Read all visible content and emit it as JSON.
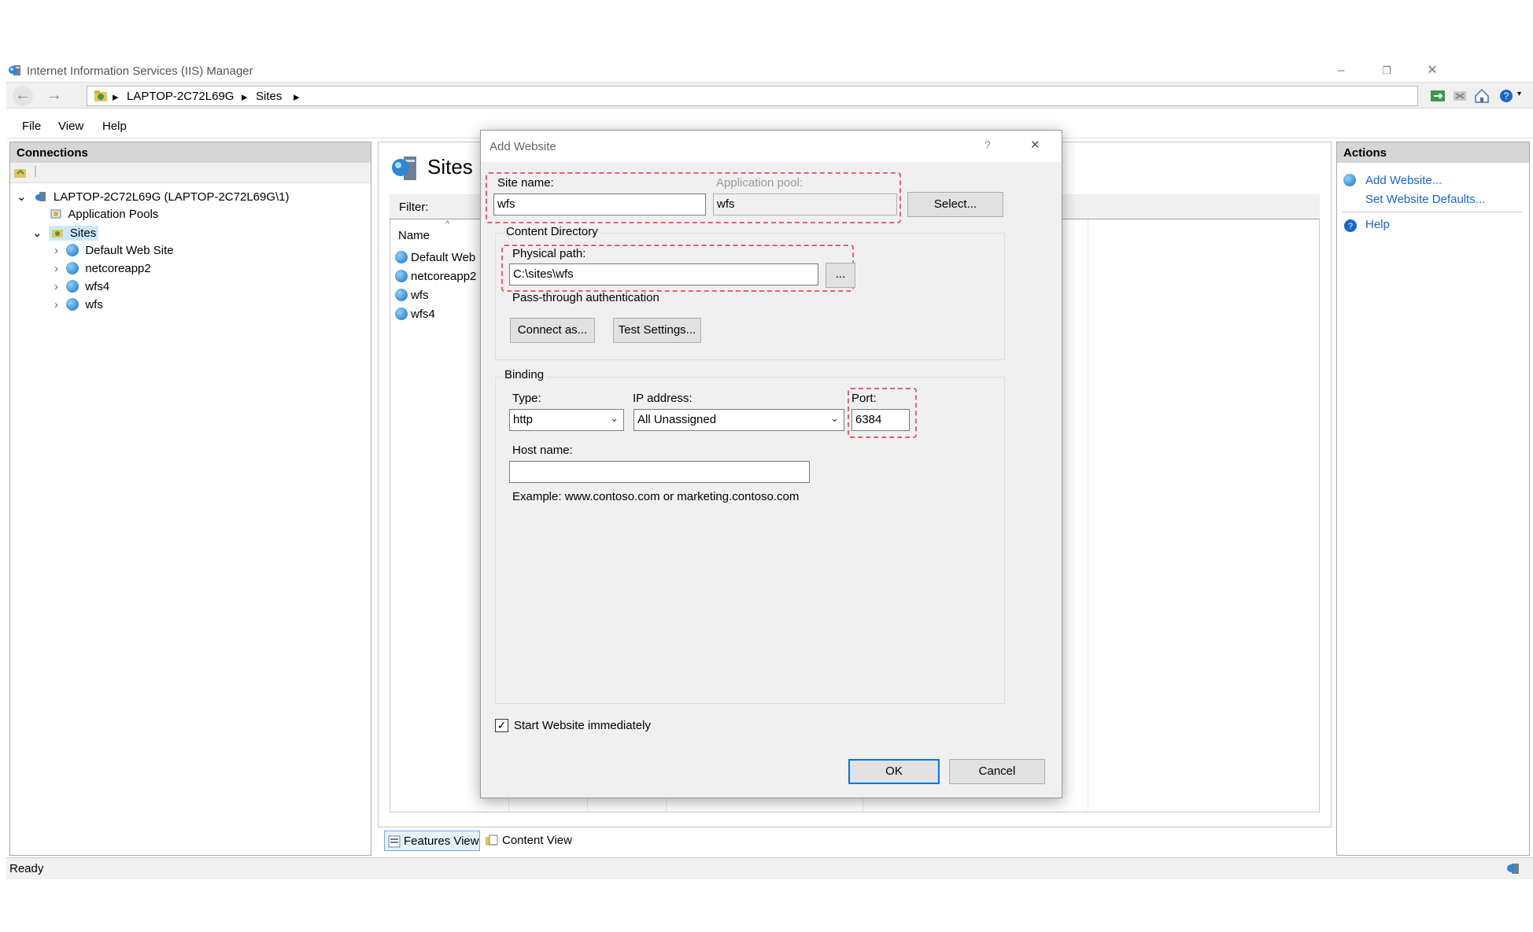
{
  "window": {
    "title": "Internet Information Services (IIS) Manager",
    "controls": {
      "minimize": "–",
      "restore": "❐",
      "close": "✕"
    }
  },
  "nav": {
    "back": "←",
    "forward": "→",
    "breadcrumb": [
      "LAPTOP-2C72L69G",
      "Sites"
    ]
  },
  "menu": [
    "File",
    "View",
    "Help"
  ],
  "connections": {
    "header": "Connections",
    "tree": {
      "server": "LAPTOP-2C72L69G (LAPTOP-2C72L69G\\1)",
      "app_pools": "Application Pools",
      "sites": "Sites",
      "site_items": [
        "Default Web Site",
        "netcoreapp2",
        "wfs4",
        "wfs"
      ]
    }
  },
  "sites_panel": {
    "title": "Sites",
    "filter_label": "Filter:",
    "column_name": "Name",
    "rows": [
      "Default Web",
      "netcoreapp2",
      "wfs",
      "wfs4"
    ]
  },
  "bottom_tabs": {
    "features": "Features View",
    "content": "Content View"
  },
  "actions": {
    "header": "Actions",
    "add_website": "Add Website...",
    "set_defaults": "Set Website Defaults...",
    "help": "Help"
  },
  "status": {
    "text": "Ready"
  },
  "dialog": {
    "title": "Add Website",
    "help_glyph": "?",
    "close_glyph": "✕",
    "site_name_label": "Site name:",
    "site_name_value": "wfs",
    "app_pool_label": "Application pool:",
    "app_pool_value": "wfs",
    "select_button": "Select...",
    "content_directory_label": "Content Directory",
    "physical_path_label": "Physical path:",
    "physical_path_value": "C:\\sites\\wfs",
    "browse_button": "...",
    "passthrough_label": "Pass-through authentication",
    "connect_as_button": "Connect as...",
    "test_settings_button": "Test Settings...",
    "binding_label": "Binding",
    "type_label": "Type:",
    "type_value": "http",
    "ip_label": "IP address:",
    "ip_value": "All Unassigned",
    "port_label": "Port:",
    "port_value": "6384",
    "host_label": "Host name:",
    "host_value": "",
    "example_text": "Example: www.contoso.com or marketing.contoso.com",
    "start_immediately_label": "Start Website immediately",
    "start_immediately_checked": true,
    "ok_button": "OK",
    "cancel_button": "Cancel"
  },
  "colors": {
    "highlight_dashed": "#e8606a",
    "link": "#1a66c2",
    "primary_border": "#0078d7"
  }
}
